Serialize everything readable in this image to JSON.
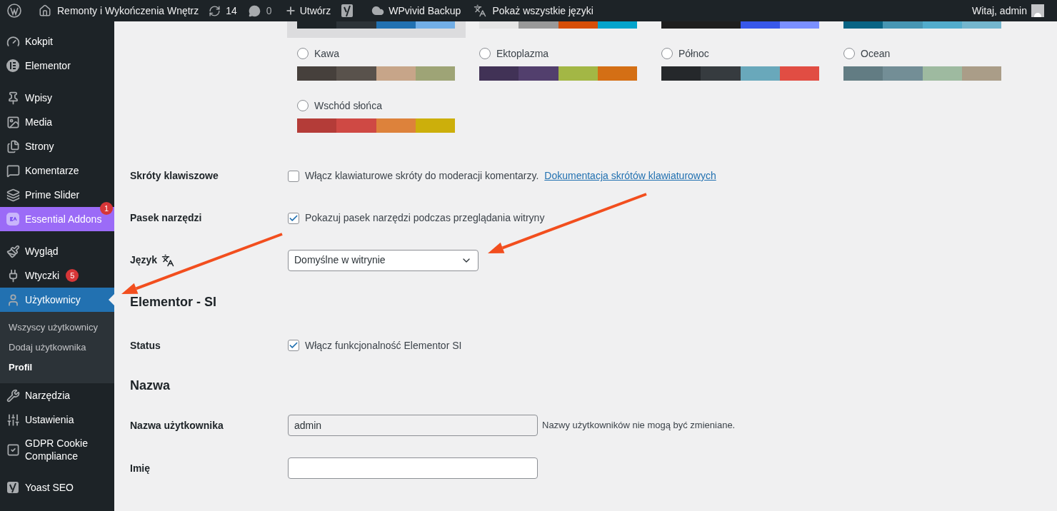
{
  "admin_bar": {
    "site_name": "Remonty i Wykończenia Wnętrz",
    "updates": "14",
    "comments": "0",
    "new": "Utwórz",
    "backup": "WPvivid Backup",
    "languages": "Pokaż wszystkie języki",
    "greeting": "Witaj, admin"
  },
  "sidebar": {
    "groups": [
      {
        "items": [
          {
            "label": "Kokpit",
            "selected": false
          },
          {
            "label": "Elementor",
            "selected": false
          }
        ]
      },
      {
        "items": [
          {
            "label": "Wpisy",
            "selected": false
          },
          {
            "label": "Media",
            "selected": false
          },
          {
            "label": "Strony",
            "selected": false
          },
          {
            "label": "Komentarze",
            "selected": false
          },
          {
            "label": "Prime Slider",
            "selected": false
          },
          {
            "label": "Essential Addons",
            "selected": false,
            "color": "#9b6bf7",
            "badge": "1"
          }
        ]
      },
      {
        "items": [
          {
            "label": "Wygląd",
            "selected": false
          },
          {
            "label": "Wtyczki",
            "selected": false,
            "badge": "5"
          },
          {
            "label": "Użytkownicy",
            "selected": true,
            "children": [
              {
                "label": "Wszyscy użytkownicy",
                "selected": false
              },
              {
                "label": "Dodaj użytkownika",
                "selected": false
              },
              {
                "label": "Profil",
                "selected": true
              }
            ]
          },
          {
            "label": "Narzędzia",
            "selected": false
          },
          {
            "label": "Ustawienia",
            "selected": false
          },
          {
            "label": "GDPR Cookie Compliance",
            "selected": false
          }
        ]
      },
      {
        "items": [
          {
            "label": "Yoast SEO",
            "selected": false
          }
        ]
      }
    ]
  },
  "color_schemes": [
    {
      "selected": true,
      "colors": [
        {
          "color": "#1d2327"
        },
        {
          "color": "#2c3338"
        },
        {
          "color": "#2271b1"
        },
        {
          "color": "#72aee6"
        }
      ]
    },
    {
      "selected": false,
      "colors": [
        {
          "color": "#e5e5e5"
        },
        {
          "color": "#999999"
        },
        {
          "color": "#d64e07"
        },
        {
          "color": "#04a4cc"
        }
      ]
    },
    {
      "selected": false,
      "colors": [
        {
          "color": "#1e1e1e"
        },
        {
          "color": "#1e1e1e"
        },
        {
          "color": "#3858e9"
        },
        {
          "color": "#7b90ff"
        }
      ]
    },
    {
      "selected": false,
      "colors": [
        {
          "color": "#096484"
        },
        {
          "color": "#4796b3"
        },
        {
          "color": "#52accc"
        },
        {
          "color": "#74b6ce"
        }
      ]
    },
    {
      "name": "Kawa",
      "selected": false,
      "colors": [
        {
          "color": "#46403c"
        },
        {
          "color": "#59524c"
        },
        {
          "color": "#c7a589"
        },
        {
          "color": "#9ea476"
        }
      ]
    },
    {
      "name": "Ektoplazma",
      "selected": false,
      "colors": [
        {
          "color": "#413256"
        },
        {
          "color": "#523f6d"
        },
        {
          "color": "#a3b745"
        },
        {
          "color": "#d46f15"
        }
      ]
    },
    {
      "name": "Północ",
      "selected": false,
      "colors": [
        {
          "color": "#25282b"
        },
        {
          "color": "#363b3f"
        },
        {
          "color": "#69a8bb"
        },
        {
          "color": "#e14d43"
        }
      ]
    },
    {
      "name": "Ocean",
      "selected": false,
      "colors": [
        {
          "color": "#627c83"
        },
        {
          "color": "#738e96"
        },
        {
          "color": "#9ebaa0"
        },
        {
          "color": "#aa9d88"
        }
      ]
    },
    {
      "name": "Wschód słońca",
      "selected": false,
      "colors": [
        {
          "color": "#b43c38"
        },
        {
          "color": "#cf4944"
        },
        {
          "color": "#dd823b"
        },
        {
          "color": "#ccaf0b"
        }
      ]
    }
  ],
  "shortcuts": {
    "label": "Skróty klawiszowe",
    "checked": false,
    "text": "Włącz klawiaturowe skróty do moderacji komentarzy.",
    "link": "Dokumentacja skrótów klawiaturowych"
  },
  "toolbar": {
    "label": "Pasek narzędzi",
    "checked": true,
    "text": "Pokazuj pasek narzędzi podczas przeglądania witryny"
  },
  "language": {
    "label": "Język",
    "value": "Domyślne w witrynie"
  },
  "elementor_section": {
    "heading": "Elementor - SI",
    "label": "Status",
    "checked": true,
    "text": "Włącz funkcjonalność Elementor SI"
  },
  "name_section": {
    "heading": "Nazwa",
    "username_label": "Nazwa użytkownika",
    "username": "admin",
    "username_note": "Nazwy użytkowników nie mogą być zmieniane.",
    "first_name_label": "Imię"
  }
}
